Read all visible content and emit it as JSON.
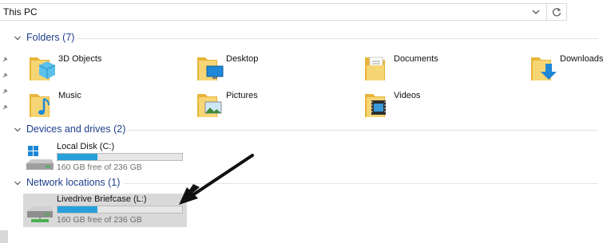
{
  "address_bar": {
    "path": "This PC",
    "chevron_icon": "chevron-down-icon",
    "refresh_icon": "refresh-icon"
  },
  "sections": {
    "folders": {
      "title": "Folders (7)"
    },
    "devices": {
      "title": "Devices and drives (2)"
    },
    "network": {
      "title": "Network locations (1)"
    }
  },
  "folders": [
    {
      "label": "3D Objects",
      "icon": "3d-objects-folder-icon"
    },
    {
      "label": "Desktop",
      "icon": "desktop-folder-icon"
    },
    {
      "label": "Documents",
      "icon": "documents-folder-icon"
    },
    {
      "label": "Downloads",
      "icon": "downloads-folder-icon"
    },
    {
      "label": "Music",
      "icon": "music-folder-icon"
    },
    {
      "label": "Pictures",
      "icon": "pictures-folder-icon"
    },
    {
      "label": "Videos",
      "icon": "videos-folder-icon"
    }
  ],
  "drives": [
    {
      "name": "Local Disk (C:)",
      "free_text": "160 GB free of 236 GB",
      "used_fraction": 0.32,
      "icon": "windows-drive-icon"
    }
  ],
  "network_locations": [
    {
      "name": "Livedrive Briefcase (L:)",
      "free_text": "160 GB free of 236 GB",
      "used_fraction": 0.32,
      "icon": "network-drive-icon",
      "selected": true
    }
  ],
  "colors": {
    "accent_blue": "#26a0da",
    "section_header": "#1e3f8c",
    "selection": "#d9d9d9",
    "folder_yellow": "#f2c94c"
  }
}
